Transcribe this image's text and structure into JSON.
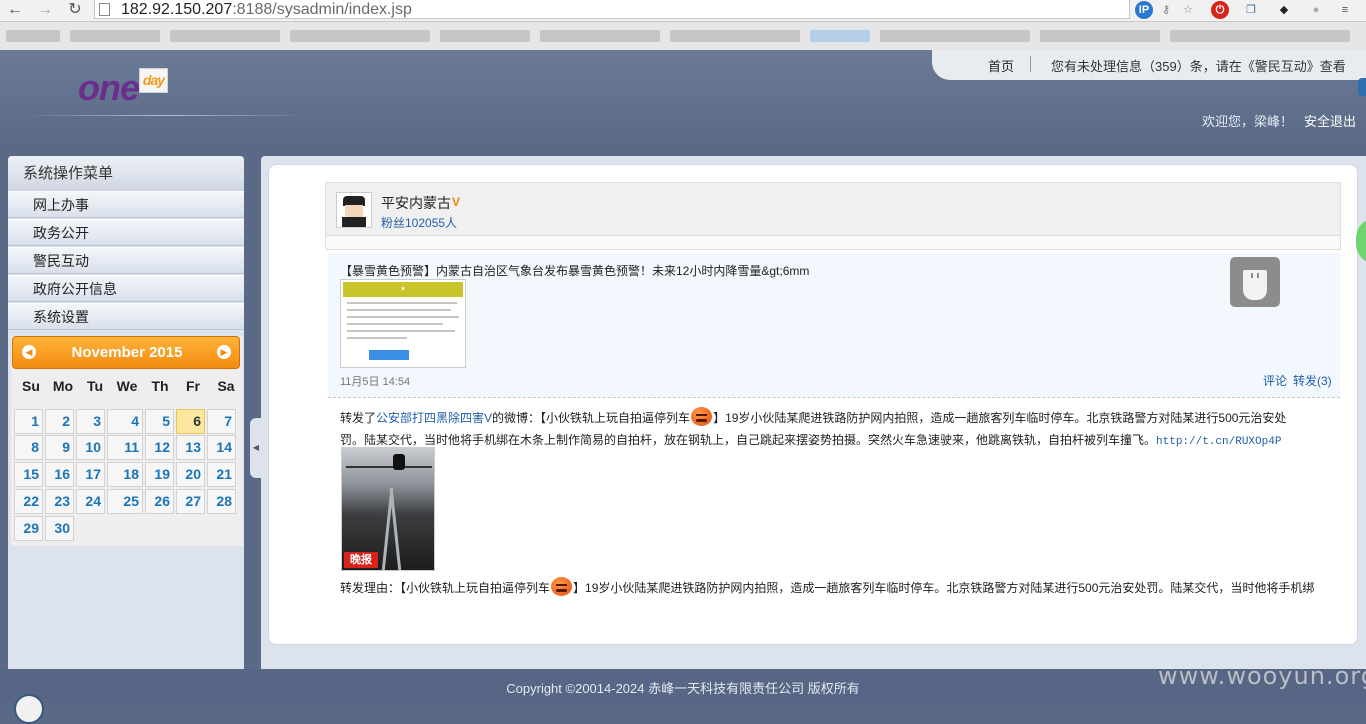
{
  "browser": {
    "url_host": "182.92.150.207",
    "url_port": ":8188",
    "url_path": "/sysadmin/index.jsp",
    "back_icon": "←",
    "forward_icon": "→",
    "reload_icon": "↻"
  },
  "header": {
    "logo_one": "one",
    "logo_day": "day",
    "nav_home": "首页",
    "notice": "您有未处理信息（359）条，请在《警民互动》查看",
    "welcome": "欢迎您，梁峰！",
    "logout": "安全退出"
  },
  "sidebar": {
    "title": "系统操作菜单",
    "items": [
      {
        "label": "网上办事"
      },
      {
        "label": "政务公开"
      },
      {
        "label": "警民互动"
      },
      {
        "label": "政府公开信息"
      },
      {
        "label": "系统设置"
      }
    ]
  },
  "calendar": {
    "month_title": "November 2015",
    "prev_icon": "◀",
    "next_icon": "▶",
    "weekdays": [
      "Su",
      "Mo",
      "Tu",
      "We",
      "Th",
      "Fr",
      "Sa"
    ],
    "days": [
      "1",
      "2",
      "3",
      "4",
      "5",
      "6",
      "7",
      "8",
      "9",
      "10",
      "11",
      "12",
      "13",
      "14",
      "15",
      "16",
      "17",
      "18",
      "19",
      "20",
      "21",
      "22",
      "23",
      "24",
      "25",
      "26",
      "27",
      "28",
      "29",
      "30"
    ],
    "today": "6"
  },
  "weibo": {
    "name": "平安内蒙古",
    "verified": "V",
    "fans": "粉丝102055人",
    "post1": {
      "text": "【暴雪黄色预警】内蒙古自治区气象台发布暴雪黄色预警！未来12小时内降雪量&gt;6mm",
      "time": "11月5日 14:54",
      "comment": "评论",
      "repost": "转发(3)"
    },
    "post2": {
      "prefix": "转发了",
      "source": "公安部打四黑除四害",
      "source_v": "V",
      "mid": "的微博：【小伙铁轨上玩自拍逼停列车",
      "body1": "】19岁小伙陆某爬进铁路防护网内拍照，造成一趟旅客列车临时停车。北京铁路警方对陆某进行500元治安处",
      "body2": "罚。陆某交代，当时他将手机绑在木条上制作简易的自拍杆，放在钢轨上，自己跳起来摆姿势拍摄。突然火车急速驶来，他跳离铁轨，自拍杆被列车撞飞。",
      "link": "http://t.cn/RUXOp4P",
      "img_brand": "晚报",
      "reason_prefix": "转发理由：【小伙铁轨上玩自拍逼停列车",
      "reason_body": "】19岁小伙陆某爬进铁路防护网内拍照，造成一趟旅客列车临时停车。北京铁路警方对陆某进行500元治安处罚。陆某交代，当时他将手机绑"
    }
  },
  "footer": {
    "copyright": "Copyright ©20014-2024 赤峰一天科技有限责任公司 版权所有",
    "watermark": "www.wooyun.org"
  }
}
